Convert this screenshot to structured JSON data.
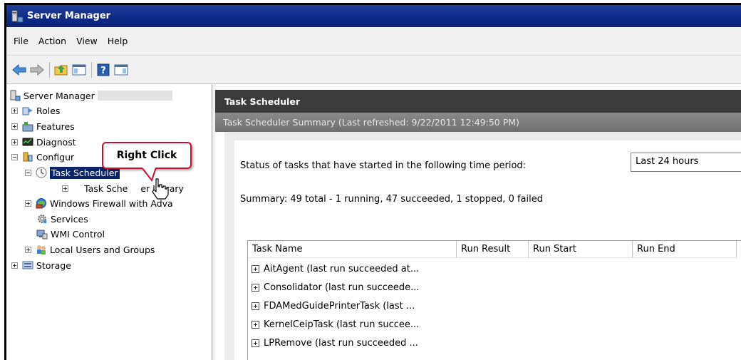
{
  "window": {
    "title": "Server Manager"
  },
  "menu": [
    "File",
    "Action",
    "View",
    "Help"
  ],
  "toolbar": {
    "icons": [
      "back-arrow-icon",
      "forward-arrow-icon",
      "up-folder-icon",
      "show-hide-tree-icon",
      "help-icon",
      "show-hide-action-pane-icon"
    ]
  },
  "tree": {
    "root": "Server Manager",
    "items": [
      {
        "label": "Roles"
      },
      {
        "label": "Features"
      },
      {
        "label": "Diagnost"
      },
      {
        "label": "Configur"
      },
      {
        "label": "Task Scheduler"
      },
      {
        "label": "Task Sche",
        "label_tail": "er Library"
      },
      {
        "label": "Windows Firewall with Adva"
      },
      {
        "label": "Services"
      },
      {
        "label": "WMI Control"
      },
      {
        "label": "Local Users and Groups"
      },
      {
        "label": "Storage"
      }
    ]
  },
  "callout": {
    "text": "Right Click"
  },
  "right": {
    "header": "Task Scheduler",
    "subheader": "Task Scheduler Summary (Last refreshed: 9/22/2011 12:49:50 PM)",
    "status_label": "Status of tasks that have started in the following time period:",
    "period": "Last 24 hours",
    "summary": "Summary: 49 total - 1 running, 47 succeeded, 1 stopped, 0 failed",
    "columns": [
      "Task Name",
      "Run Result",
      "Run Start",
      "Run End"
    ],
    "rows": [
      "AitAgent (last run succeeded at...",
      "Consolidator (last run succeede...",
      "FDAMedGuidePrinterTask (last ...",
      "KernelCeipTask (last run succee...",
      "LPRemove (last run succeeded ..."
    ]
  },
  "colors": {
    "title_bar": "#0d2a86",
    "selection": "#0a246a",
    "callout_border": "#c8102e",
    "pane_header": "#3b3b3b"
  }
}
